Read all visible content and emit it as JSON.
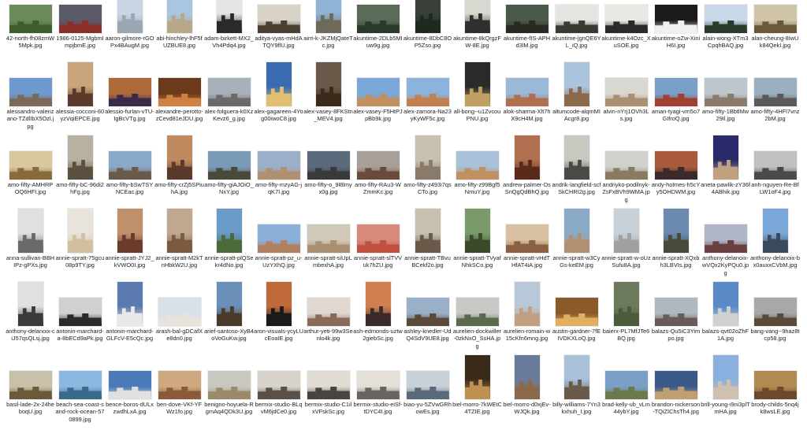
{
  "files": [
    {
      "name": "42-north-fh08zmW5Mpk.jpg",
      "shape": "land",
      "sky": "#6b8a5a",
      "fg": "#3f5c2b"
    },
    {
      "name": "1986-0125-MgbmImpjbmE.jpg",
      "shape": "land",
      "sky": "#5a5a66",
      "fg": "#8a2e2a"
    },
    {
      "name": "aaron-gilmore-rGOPx4BAugM.jpg",
      "shape": "port",
      "sky": "#c9d6e4",
      "fg": "#9aa6b2"
    },
    {
      "name": "abi-hinchley-lhF5fUZBUE8.jpg",
      "shape": "port",
      "sky": "#a9c6e0",
      "fg": "#b8a88a"
    },
    {
      "name": "adam-birkett-MX2_Vh4Pdq4.jpg",
      "shape": "port",
      "sky": "#e6e6e8",
      "fg": "#2a2a2a"
    },
    {
      "name": "aditya-vyas-mHdATQY9flU.jpg",
      "shape": "land",
      "sky": "#d8d4c8",
      "fg": "#4a3f30"
    },
    {
      "name": "airri-k-JKZMjQateTc.jpg",
      "shape": "port",
      "sky": "#8fb3d6",
      "fg": "#6d6a5a"
    },
    {
      "name": "akuntime-2DLb5MIuw9g.jpg",
      "shape": "land",
      "sky": "#5a6b5a",
      "fg": "#2a3a2a"
    },
    {
      "name": "akuntime-8DbC8OP5Zso.jpg",
      "shape": "port",
      "sky": "#3a3f3a",
      "fg": "#1f2a1f"
    },
    {
      "name": "akuntime-8kQrgzFW-8E.jpg",
      "shape": "port",
      "sky": "#d8d8d0",
      "fg": "#2f2f2f"
    },
    {
      "name": "akuntime-fIS-APHd3lM.jpg",
      "shape": "land",
      "sky": "#4a5a4a",
      "fg": "#2a2a24"
    },
    {
      "name": "akuntime-jgnQE6YL_iQ.jpg",
      "shape": "land",
      "sky": "#e4e4e0",
      "fg": "#3a3a34"
    },
    {
      "name": "akuntime-k4Ozc_XuSOE.jpg",
      "shape": "land",
      "sky": "#e8e8e4",
      "fg": "#2a2a2a"
    },
    {
      "name": "akuntime-oZw-XiniH6I.jpg",
      "shape": "land",
      "sky": "#1a1a1a",
      "fg": "#f0f0ee"
    },
    {
      "name": "alain-wong-XTm3CpqhBAQ.jpg",
      "shape": "land",
      "sky": "#c9d8e8",
      "fg": "#2a3a2a"
    },
    {
      "name": "alan-cheung-8IwUk84QekI.jpg",
      "shape": "land",
      "sky": "#cfc4a8",
      "fg": "#6a5a3a"
    },
    {
      "name": "alessandro-valenzano-TZdlIbX5Ozl.jpg",
      "shape": "land",
      "sky": "#6f9ad0",
      "fg": "#7a6a5a"
    },
    {
      "name": "alessia-cocconi-60yzVqiEPCE.jpg",
      "shape": "port",
      "sky": "#caa47a",
      "fg": "#5a3a2a"
    },
    {
      "name": "alessio-furlan-vTU-IgBcVTg.jpg",
      "shape": "land",
      "sky": "#b06a3a",
      "fg": "#3a2a4a"
    },
    {
      "name": "alexandre-perotto-zCevd81eJDU.jpg",
      "shape": "land",
      "sky": "#6a3a1a",
      "fg": "#d08040"
    },
    {
      "name": "alex-folguera-k0XzKevz6_g.jpg",
      "shape": "land",
      "sky": "#a8b0ba",
      "fg": "#6a6a6a"
    },
    {
      "name": "alex-gagareen-4Yog00iwoC8.jpg",
      "shape": "port",
      "sky": "#3a6ab0",
      "fg": "#e0c070"
    },
    {
      "name": "alex-vasey-8FKStn_MEV4.jpg",
      "shape": "port",
      "sky": "#6a5a4a",
      "fg": "#3a2a1a"
    },
    {
      "name": "alex-vasey-F5HtPJpBb9k.jpg",
      "shape": "land",
      "sky": "#7aa8d8",
      "fg": "#c09060"
    },
    {
      "name": "alex-zamora-Na23yKyWF5c.jpg",
      "shape": "land",
      "sky": "#8ab4dc",
      "fg": "#c08050"
    },
    {
      "name": "all-bong--u1ZvcouPNU.jpg",
      "shape": "port",
      "sky": "#2a2a2a",
      "fg": "#c0a060"
    },
    {
      "name": "alok-sharma-Xlt7hX9cH4M.jpg",
      "shape": "land",
      "sky": "#9ab8d8",
      "fg": "#b07050"
    },
    {
      "name": "altumcode-alqmMIAcgr8.jpg",
      "shape": "port",
      "sky": "#aac4de",
      "fg": "#8a6a4a"
    },
    {
      "name": "alvin-nYrj1OVh3Ls.jpg",
      "shape": "land",
      "sky": "#d8d8d0",
      "fg": "#a89070"
    },
    {
      "name": "aman-tyagi-vm5o7GIfroQ.jpg",
      "shape": "land",
      "sky": "#7aa0c8",
      "fg": "#a04030"
    },
    {
      "name": "amo-fifty-1BbtlMw29Il.jpg",
      "shape": "land",
      "sky": "#bcc6cc",
      "fg": "#8a7a6a"
    },
    {
      "name": "amo-fifty-4HFl7vnz2bM.jpg",
      "shape": "land",
      "sky": "#9ab0c0",
      "fg": "#5a5a5a"
    },
    {
      "name": "amo-fifty-AMHRPOQ6HFI.jpg",
      "shape": "land",
      "sky": "#d8c8a0",
      "fg": "#8a6a3a"
    },
    {
      "name": "amo-fifty-bC-96di2hFg.jpg",
      "shape": "port",
      "sky": "#b8b0a0",
      "fg": "#5a5040"
    },
    {
      "name": "amo-fifty-bSwTSYNCEac.jpg",
      "shape": "land",
      "sky": "#8aa8c8",
      "fg": "#6a5a4a"
    },
    {
      "name": "amo-fifty-crZj5SPiuhA.jpg",
      "shape": "port",
      "sky": "#c08a60",
      "fg": "#5a3a2a"
    },
    {
      "name": "amo-fifty-giAJOiO_NxY.jpg",
      "shape": "land",
      "sky": "#7a9ab8",
      "fg": "#4a4a3a"
    },
    {
      "name": "amo-fifty-mzyAG-jqK7I.jpg",
      "shape": "land",
      "sky": "#9ab0c8",
      "fg": "#b09070"
    },
    {
      "name": "amo-fifty-o_9l8lmyx0g.jpg",
      "shape": "land",
      "sky": "#5a6a7a",
      "fg": "#3a3a3a"
    },
    {
      "name": "amo-fifty-RAu3-WZmmKc.jpg",
      "shape": "land",
      "sky": "#a8a098",
      "fg": "#6a4a3a"
    },
    {
      "name": "amo-fifty-z493i7qsCTo.jpg",
      "shape": "port",
      "sky": "#c8c0b0",
      "fg": "#8a7a6a"
    },
    {
      "name": "amo-fifty-z99Bgf5NmuY.jpg",
      "shape": "land",
      "sky": "#a8c0d8",
      "fg": "#c09060"
    },
    {
      "name": "andrew-palmer-DsSnQgQdBhQ.jpg",
      "shape": "port",
      "sky": "#b07050",
      "fg": "#5a2a1a"
    },
    {
      "name": "andrik-langfield-scfSkCHRI2g.jpg",
      "shape": "port",
      "sky": "#c8c8c0",
      "fg": "#4a4a44"
    },
    {
      "name": "andriyko-podilnyk-ZsFxBVh9WMA.jpg",
      "shape": "land",
      "sky": "#d0d0cc",
      "fg": "#8a7a60"
    },
    {
      "name": "andy-holmes-h5cYy5OHDWM.jpg",
      "shape": "land",
      "sky": "#a85a3a",
      "fg": "#3a2a2a"
    },
    {
      "name": "aneta-pawlik-zY36f4ABhik.jpg",
      "shape": "port",
      "sky": "#2a2a6a",
      "fg": "#c0a080"
    },
    {
      "name": "anh-nguyen-Re-BfLW1oF4.jpg",
      "shape": "land",
      "sky": "#c0c0c0",
      "fg": "#4a4a4a"
    },
    {
      "name": "anna-sullivan-BBHIPz-gPXs.jpg",
      "shape": "port",
      "sky": "#e0e0e0",
      "fg": "#6a6a6a"
    },
    {
      "name": "annie-spratt-75gcu08p9TY.jpg",
      "shape": "port",
      "sky": "#e8e4dc",
      "fg": "#d0c0a0"
    },
    {
      "name": "annie-spratt-JYJ2_kVWO0I.jpg",
      "shape": "port",
      "sky": "#c0906a",
      "fg": "#6a3a2a"
    },
    {
      "name": "annie-spratt-M2kTnHbkW2U.jpg",
      "shape": "port",
      "sky": "#c0a890",
      "fg": "#7a5a40"
    },
    {
      "name": "annie-spratt-plQSekr4dNo.jpg",
      "shape": "port",
      "sky": "#6a9ac8",
      "fg": "#4a6a3a"
    },
    {
      "name": "annie-spratt-pz_u-UzYXhQ.jpg",
      "shape": "land",
      "sky": "#8ab0d8",
      "fg": "#b08060"
    },
    {
      "name": "annie-spratt-siUpLmbexhA.jpg",
      "shape": "land",
      "sky": "#d0c8b8",
      "fg": "#a89070"
    },
    {
      "name": "annie-spratt-slTVVuk7hZU.jpg",
      "shape": "land",
      "sky": "#d88a7a",
      "fg": "#c05040"
    },
    {
      "name": "annie-spratt-TBvuBCekf2o.jpg",
      "shape": "port",
      "sky": "#c8c0b0",
      "fg": "#6a5a4a"
    },
    {
      "name": "annie-spratt-TVyafNhkSCo.jpg",
      "shape": "port",
      "sky": "#7a9a6a",
      "fg": "#3a4a2a"
    },
    {
      "name": "annie-spratt-vHdTHfAT4iA.jpg",
      "shape": "land",
      "sky": "#d8c0a0",
      "fg": "#8a6040"
    },
    {
      "name": "annie-spratt-w3CyGs-keEM.jpg",
      "shape": "port",
      "sky": "#8aaac8",
      "fg": "#b09070"
    },
    {
      "name": "annie-spratt-w-oUzSufu8A.jpg",
      "shape": "port",
      "sky": "#c8d0d8",
      "fg": "#a0a0a0"
    },
    {
      "name": "annie-spratt-XQxbh3LBVIs.jpg",
      "shape": "port",
      "sky": "#6a8ab0",
      "fg": "#4a4a3a"
    },
    {
      "name": "anthony-delanoix-wVQx2KyPQu0.jpg",
      "shape": "land",
      "sky": "#b0b8c8",
      "fg": "#6a4040"
    },
    {
      "name": "anthony-delanoix-bx0auxxCVbM.jpg",
      "shape": "port",
      "sky": "#7aa8d8",
      "fg": "#3a4a5a"
    },
    {
      "name": "anthony-delanoix-ciJ57qsQLsj.jpg",
      "shape": "port",
      "sky": "#e0e0e0",
      "fg": "#3a3a3a"
    },
    {
      "name": "antonin-marchard-a-8bECd9aPk.jpg",
      "shape": "land",
      "sky": "#d0d0d0",
      "fg": "#2a2a2a"
    },
    {
      "name": "antonin-marchard-GLFcV-E5cQc.jpg",
      "shape": "port",
      "sky": "#5a7ab0",
      "fg": "#e8e8e8"
    },
    {
      "name": "arash-bal-gDCafXe8dn0.jpg",
      "shape": "land",
      "sky": "#d8e0e8",
      "fg": "#e8e4dc"
    },
    {
      "name": "arief-santoso-XyB4oVoGuKw.jpg",
      "shape": "port",
      "sky": "#6a90b8",
      "fg": "#4a3a2a"
    },
    {
      "name": "aron-visuals-ycyLUcEoaIE.jpg",
      "shape": "port",
      "sky": "#c06a3a",
      "fg": "#1a1a1a"
    },
    {
      "name": "arthur-yeti-99w3Senlo4k.jpg",
      "shape": "land",
      "sky": "#e0d8d0",
      "fg": "#8a6a5a"
    },
    {
      "name": "ash-edmonds-uztw2giebSc.jpg",
      "shape": "port",
      "sky": "#d08050",
      "fg": "#3a2a2a"
    },
    {
      "name": "ashley-knedler-UdQ4SdV9UE8.jpg",
      "shape": "land",
      "sky": "#9ab0c8",
      "fg": "#5a4a3a"
    },
    {
      "name": "aurelien-dockwiller-0zkNxO_SsHA.jpg",
      "shape": "land",
      "sky": "#c8c8c4",
      "fg": "#5a6a4a"
    },
    {
      "name": "aurelien-romain-w15cKfn6mng.jpg",
      "shape": "port",
      "sky": "#b8c8d8",
      "fg": "#c0a080"
    },
    {
      "name": "austin-gardner-7fEIVDKXLoQ.jpg",
      "shape": "land",
      "sky": "#8a5a2a",
      "fg": "#e0b060"
    },
    {
      "name": "baierx-PL7MfJTe6BQ.jpg",
      "shape": "port",
      "sky": "#6a7a5a",
      "fg": "#4a5a3a"
    },
    {
      "name": "balazs-Qu5iC3Yimpo.jpg",
      "shape": "land",
      "sky": "#b0b8c0",
      "fg": "#6a5a5a"
    },
    {
      "name": "balazs-qvt02oZhF1A.jpg",
      "shape": "port",
      "sky": "#5a8ac8",
      "fg": "#d0d0d0"
    },
    {
      "name": "bang-vang--9haz8tcp58.jpg",
      "shape": "land",
      "sky": "#a8a8a8",
      "fg": "#5a4a3a"
    },
    {
      "name": "basil-lade-2x-24heboqU.jpg",
      "shape": "land",
      "sky": "#c8c0a8",
      "fg": "#6a5a3a"
    },
    {
      "name": "beach-sea-coast-sand-rock-ocean-570899.jpg",
      "shape": "land",
      "sky": "#8ab8e0",
      "fg": "#3a6a8a"
    },
    {
      "name": "bence-boros-dULxzwdhLxA.jpg",
      "shape": "land",
      "sky": "#4a7ab8",
      "fg": "#e0e0e0"
    },
    {
      "name": "ben-dove-VKf-YFWz1fo.jpg",
      "shape": "land",
      "sky": "#d0a880",
      "fg": "#8a5a3a"
    },
    {
      "name": "benigno-hoyuela-RgmAq4QDk3U.jpg",
      "shape": "land",
      "sky": "#c8c8c0",
      "fg": "#9a8a6a"
    },
    {
      "name": "bermix-studio-BLqvM6jdCe0.jpg",
      "shape": "land",
      "sky": "#d8d4cc",
      "fg": "#5a5048"
    },
    {
      "name": "bermix-studio-C1ilxVFskSc.jpg",
      "shape": "land",
      "sky": "#e0dcd4",
      "fg": "#4a4440"
    },
    {
      "name": "bermix-studio-eiSf-tDYC4I.jpg",
      "shape": "land",
      "sky": "#e4e0d8",
      "fg": "#6a6460"
    },
    {
      "name": "biao-yu-5ZVwGRhowEs.jpg",
      "shape": "land",
      "sky": "#c8d0d8",
      "fg": "#5a6a7a"
    },
    {
      "name": "biel-morro-7kWEtC4TZIE.jpg",
      "shape": "port",
      "sky": "#3a2a1a",
      "fg": "#c09050"
    },
    {
      "name": "biel-morro-d0xjEv-WJQk.jpg",
      "shape": "port",
      "sky": "#6a7a9a",
      "fg": "#8a6a4a"
    },
    {
      "name": "billy-williams-7Yn3kxhuh_I.jpg",
      "shape": "port",
      "sky": "#a8c0d8",
      "fg": "#6a5a4a"
    },
    {
      "name": "brad-kelly-ub_vLm44ybY.jpg",
      "shape": "land",
      "sky": "#7aa0c8",
      "fg": "#6a7a4a"
    },
    {
      "name": "brandon-nickerson-TQiZIChsTh4.jpg",
      "shape": "land",
      "sky": "#3a5a8a",
      "fg": "#c0a070"
    },
    {
      "name": "brill-young-i9ni3plTmHA.jpg",
      "shape": "port",
      "sky": "#8ab0e0",
      "fg": "#d0c0b0"
    },
    {
      "name": "brody-childs-5nq4jk8wsLE.jpg",
      "shape": "land",
      "sky": "#b08a50",
      "fg": "#6a4a2a"
    }
  ]
}
